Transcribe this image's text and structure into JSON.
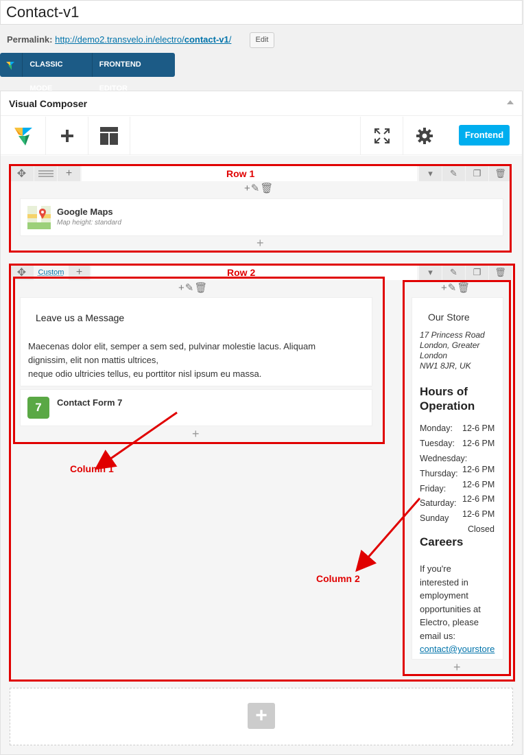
{
  "title": "Contact-v1",
  "permalink": {
    "label": "Permalink:",
    "url_prefix": "http://demo2.transvelo.in/electro/",
    "url_slug": "contact-v1",
    "url_suffix": "/",
    "edit_label": "Edit"
  },
  "mode_bar": {
    "classic": "CLASSIC MODE",
    "frontend": "FRONTEND EDITOR"
  },
  "vc": {
    "title": "Visual Composer",
    "frontend_button": "Frontend"
  },
  "row1": {
    "label": "Row 1",
    "element": {
      "title": "Google Maps",
      "subtitle": "Map height: standard"
    }
  },
  "row2": {
    "label": "Row 2",
    "layout_label": "Custom",
    "col1": {
      "heading": "Leave us a Message",
      "paragraph_line1": "Maecenas dolor elit, semper a sem sed, pulvinar molestie lacus. Aliquam",
      "paragraph_line2": "dignissim, elit non mattis ultrices,",
      "paragraph_line3": "neque odio ultricies tellus, eu porttitor nisl ipsum eu massa.",
      "form_title": "Contact Form 7",
      "form_badge": "7",
      "label": "Column 1"
    },
    "col2": {
      "store_title": "Our Store",
      "address": [
        "17 Princess Road",
        "London, Greater",
        "London",
        "NW1 8JR, UK"
      ],
      "hours_title_1": "Hours of",
      "hours_title_2": "Operation",
      "hours": [
        {
          "day": "Monday:",
          "time": "12-6 PM"
        },
        {
          "day": "Tuesday:",
          "time": "12-6 PM"
        },
        {
          "day": "Wednesday:",
          "time": ""
        },
        {
          "day": "Thursday:",
          "time": "12-6 PM"
        },
        {
          "day": "Friday:",
          "time": "12-6 PM"
        },
        {
          "day": "Saturday:",
          "time": "12-6 PM"
        },
        {
          "day": "Sunday",
          "time": "12-6 PM"
        }
      ],
      "closed": "Closed",
      "careers_title": "Careers",
      "careers_lines": [
        "If you're",
        "interested in",
        "employment",
        "opportunities at",
        "Electro, please",
        "email us:"
      ],
      "email": "contact@yourstore",
      "label": "Column 2"
    }
  },
  "colors": {
    "accent": "#00aeef",
    "annotation": "#e00000",
    "mode_bar": "#1c5b86"
  }
}
